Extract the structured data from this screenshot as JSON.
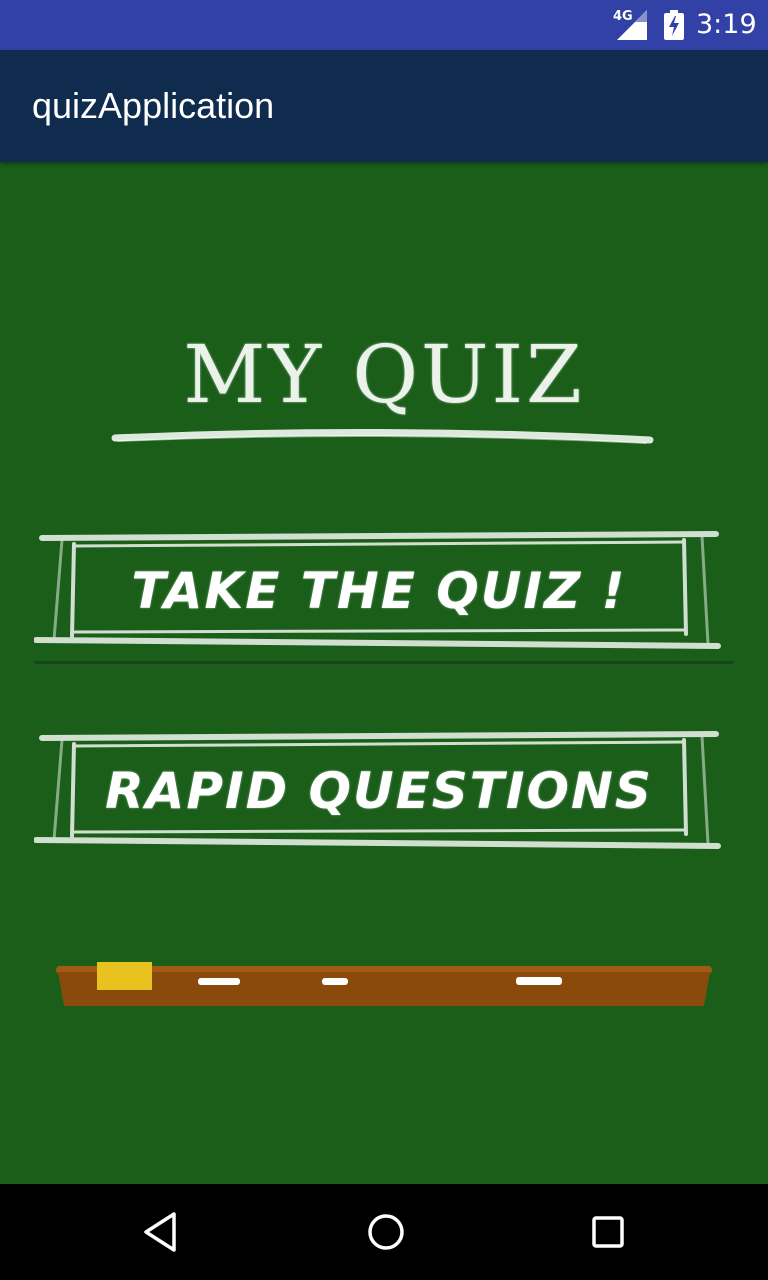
{
  "status_bar": {
    "network": "4G",
    "time": "3:19",
    "icons": [
      "signal-icon",
      "battery-charging-icon"
    ]
  },
  "app_bar": {
    "title": "quizApplication"
  },
  "main": {
    "heading": "MY QUIZ",
    "buttons": [
      {
        "label": "TAKE THE QUIZ !"
      },
      {
        "label": "RAPID QUESTIONS"
      }
    ]
  },
  "nav_bar": {
    "icons": [
      "back-icon",
      "home-icon",
      "recents-icon"
    ]
  },
  "colors": {
    "status_bar": "#3241a6",
    "app_bar": "#0f2c4e",
    "chalkboard": "#1a5e1a",
    "chalk": "#eef4ee",
    "tray": "#8a4a0c"
  }
}
